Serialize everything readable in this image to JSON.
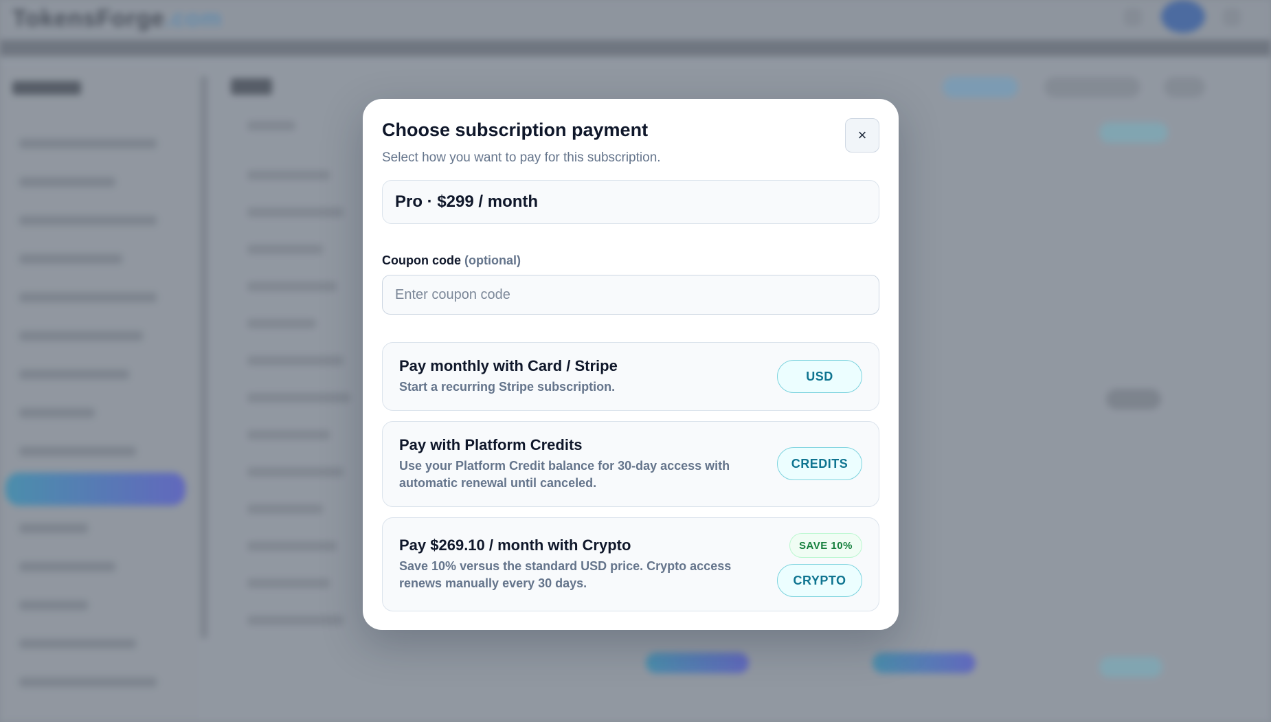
{
  "background": {
    "logo_text": "TokensForge",
    "logo_suffix": ".com",
    "page_title": "Bills"
  },
  "modal": {
    "title": "Choose subscription payment",
    "subtitle": "Select how you want to pay for this subscription.",
    "close_label": "×",
    "plan_summary": "Pro · $299 / month",
    "coupon": {
      "label": "Coupon code",
      "optional": "(optional)",
      "placeholder": "Enter coupon code",
      "value": ""
    },
    "options": [
      {
        "title": "Pay monthly with Card / Stripe",
        "description": "Start a recurring Stripe subscription.",
        "button": "USD"
      },
      {
        "title": "Pay with Platform Credits",
        "description": "Use your Platform Credit balance for 30-day access with automatic renewal until canceled.",
        "button": "CREDITS"
      },
      {
        "title": "Pay $269.10 / month with Crypto",
        "description": "Save 10% versus the standard USD price. Crypto access renews manually every 30 days.",
        "badge": "SAVE 10%",
        "button": "CRYPTO"
      }
    ]
  },
  "colors": {
    "accent": "#0e7490",
    "accent_bg": "#ecfeff",
    "success": "#15803d",
    "text_primary": "#0f172a",
    "text_secondary": "#64748b"
  },
  "icons": {
    "close": "close-icon"
  }
}
